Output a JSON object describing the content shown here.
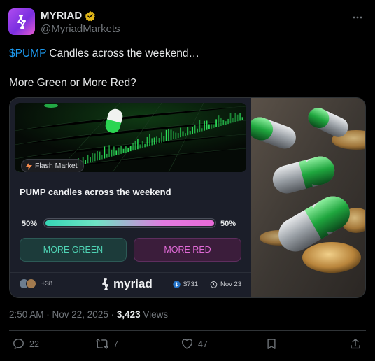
{
  "author": {
    "display_name": "MYRIAD",
    "handle": "@MyriadMarkets",
    "verified": "gold-check-badge"
  },
  "post": {
    "cashtag": "$PUMP",
    "line1_rest": " Candles across the weekend…",
    "line2": "More Green or More Red?"
  },
  "card": {
    "badge": "Flash Market",
    "title": "PUMP candles across the weekend",
    "left_pct": "50%",
    "right_pct": "50%",
    "green_share": 0.5,
    "option_green": "MORE GREEN",
    "option_red": "MORE RED",
    "participants_count": "+38",
    "brand": "myriad",
    "volume": "$731",
    "end_date": "Nov 23"
  },
  "meta": {
    "time": "2:50 AM · Nov 22, 2025 · ",
    "views_count": "3,423",
    "views_label": " Views"
  },
  "actions": {
    "replies": "22",
    "reposts": "7",
    "likes": "47"
  },
  "colors": {
    "link": "#1d9bf0",
    "green_option": "#4fd3b4",
    "red_option": "#e06ad6",
    "verified": "#e2b719"
  }
}
